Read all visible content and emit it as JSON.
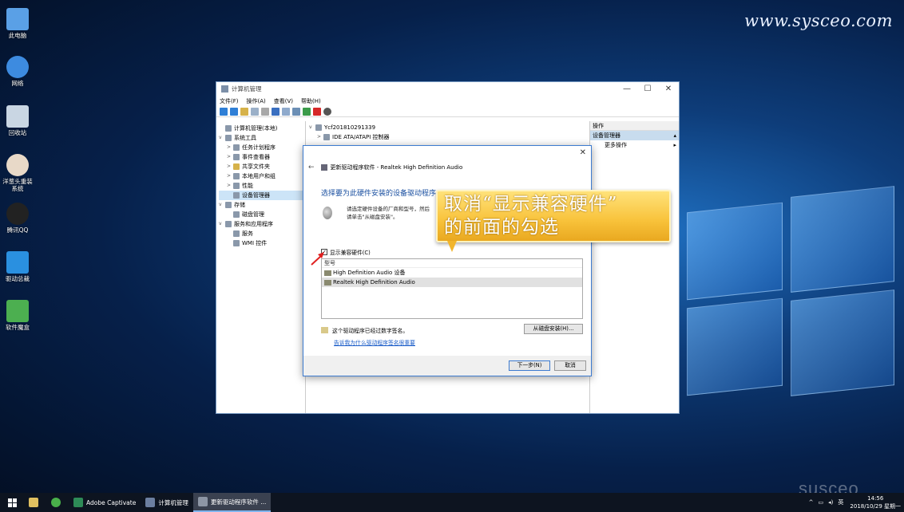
{
  "watermark": "www.sysceo.com",
  "brand_mark": "susceo",
  "desktop_icons": [
    {
      "label": "此电脑",
      "color": "#5aa0e6"
    },
    {
      "label": "网络",
      "color": "#3d8be0"
    },
    {
      "label": "回收站",
      "color": "#c9d6e3"
    },
    {
      "label": "洋葱头重装系统",
      "color": "#e8d9c8"
    },
    {
      "label": "腾讯QQ",
      "color": "#222222"
    },
    {
      "label": "驱动总裁",
      "color": "#2a90e0"
    },
    {
      "label": "软件魔盒",
      "color": "#4caf50"
    }
  ],
  "window": {
    "title": "计算机管理",
    "controls": [
      "—",
      "☐",
      "✕"
    ],
    "menu": [
      "文件(F)",
      "操作(A)",
      "查看(V)",
      "帮助(H)"
    ],
    "tree": [
      {
        "label": "计算机管理(本地)",
        "exp": ""
      },
      {
        "label": "系统工具",
        "exp": "v"
      },
      {
        "label": "任务计划程序",
        "exp": ">"
      },
      {
        "label": "事件查看器",
        "exp": ">"
      },
      {
        "label": "共享文件夹",
        "exp": ">"
      },
      {
        "label": "本地用户和组",
        "exp": ">"
      },
      {
        "label": "性能",
        "exp": ">"
      },
      {
        "label": "设备管理器",
        "exp": ""
      },
      {
        "label": "存储",
        "exp": "v"
      },
      {
        "label": "磁盘管理",
        "exp": ""
      },
      {
        "label": "服务和应用程序",
        "exp": "v"
      },
      {
        "label": "服务",
        "exp": ""
      },
      {
        "label": "WMI 控件",
        "exp": ""
      }
    ],
    "device_root": "Ycf201810291339",
    "device_child": "IDE ATA/ATAPI 控制器",
    "actions_header": "操作",
    "actions_section": "设备管理器",
    "actions_more": "更多操作"
  },
  "dialog": {
    "title": "更新驱动程序软件 - Realtek High Definition Audio",
    "subtitle": "选择要为此硬件安装的设备驱动程序",
    "instruction_1": "请选定硬件设备的厂商和型号，然后",
    "instruction_2": "请单击\"从磁盘安装\"。",
    "checkbox_label": "显示兼容硬件(C)",
    "checkbox_checked": true,
    "list_header": "型号",
    "models": [
      "High Definition Audio 设备",
      "Realtek High Definition Audio"
    ],
    "signed_text": "这个驱动程序已经过数字签名。",
    "signed_link": "告诉我为什么驱动程序签名很重要",
    "disk_button": "从磁盘安装(H)...",
    "next_button": "下一步(N)",
    "cancel_button": "取消",
    "close_icon": "✕"
  },
  "callout": {
    "line1": "取消“显示兼容硬件”",
    "line2": "的前面的勾选"
  },
  "taskbar": {
    "apps": [
      {
        "label": "",
        "color": "#e0c060"
      },
      {
        "label": "",
        "color": "#49b04a"
      },
      {
        "label": "Adobe Captivate",
        "color": "#2e8b57"
      },
      {
        "label": "计算机管理",
        "color": "#6c7fa0"
      },
      {
        "label": "更新驱动程序软件 ...",
        "color": "#8d96a5",
        "active": true
      }
    ],
    "tray_lang": "英",
    "time": "14:56",
    "date": "2018/10/29 星期一"
  }
}
